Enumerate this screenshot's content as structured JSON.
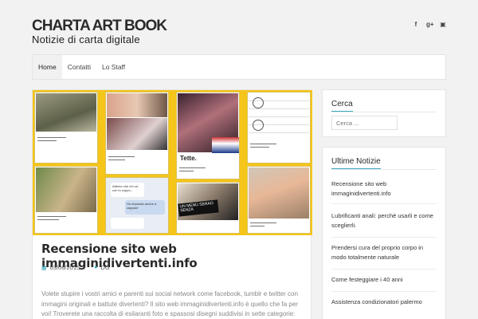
{
  "site": {
    "title": "CHARTA ART BOOK",
    "description": "Notizie di carta digitale"
  },
  "social_icons": [
    "facebook-icon",
    "google-plus-icon",
    "youtube-icon"
  ],
  "social_glyphs": {
    "facebook": "f",
    "google_plus": "g+",
    "youtube": "▣"
  },
  "nav": {
    "items": [
      {
        "label": "Home",
        "active": true
      },
      {
        "label": "Contatti",
        "active": false
      },
      {
        "label": "Lo Staff",
        "active": false
      }
    ]
  },
  "post": {
    "title": "Recensione sito web immaginidivertenti.info",
    "date": "03/06/2015",
    "author": "DG",
    "excerpt": "Volete stupire i vostri amici e parenti sui social network come facebook, tumblr e twitter con immagini originali e battute divertenti? Il sito web immaginidivertenti.info è quello che fa per voi! Troverete una raccolta di esilaranti foto e spassosi disegni suddivisi in sette categorie: Citazioni",
    "image_texts": {
      "tette": "Tette.",
      "un_menu": "UN MENÚ SERAO SENZA",
      "chat_bubble": "Ho imparato anche a zappare"
    }
  },
  "colors": {
    "accent": "#3da6bd",
    "image_bg": "#f5c51a"
  },
  "sidebar": {
    "search": {
      "title": "Cerca",
      "placeholder": "Cerca ..."
    },
    "latest": {
      "title": "Ultime Notizie",
      "items": [
        "Recensione sito web immaginidivertenti.info",
        "Lubrificanti anali: perché usarli e come sceglierli.",
        "Prendersi cura del proprio corpo in modo totalmente naturale",
        "Come festeggiare i 40 anni",
        "Assistenza condizionatori palermo"
      ]
    }
  }
}
